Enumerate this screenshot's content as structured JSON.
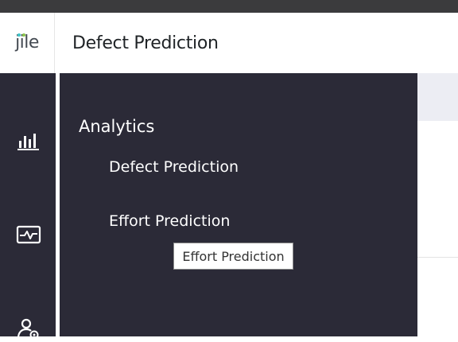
{
  "app": {
    "logo_text": "jile",
    "logo_dot_colors": [
      "#3cc4c9",
      "#8bc34a"
    ],
    "page_title": "Defect Prediction"
  },
  "rail": {
    "icons": [
      "bar-chart-icon",
      "activity-monitor-icon",
      "user-settings-icon"
    ]
  },
  "flyout": {
    "heading": "Analytics",
    "items": [
      {
        "label": "Defect Prediction"
      },
      {
        "label": "Effort Prediction"
      }
    ]
  },
  "tooltip": {
    "text": "Effort Prediction"
  },
  "colors": {
    "top_strip": "#3b3b3d",
    "nav_background": "#2b2a37",
    "nav_text": "#ffffff",
    "content_tabbar": "#ecedf3"
  }
}
